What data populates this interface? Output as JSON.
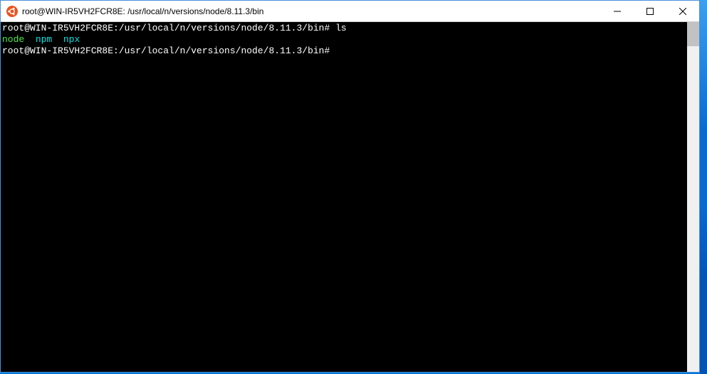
{
  "window": {
    "title": "root@WIN-IR5VH2FCR8E: /usr/local/n/versions/node/8.11.3/bin"
  },
  "terminal": {
    "line1_prompt": "root@WIN-IR5VH2FCR8E:/usr/local/n/versions/node/8.11.3/bin#",
    "line1_cmd": " ls",
    "ls_node": "node",
    "ls_sep1": "  ",
    "ls_npm": "npm",
    "ls_sep2": "  ",
    "ls_npx": "npx",
    "line3_prompt": "root@WIN-IR5VH2FCR8E:/usr/local/n/versions/node/8.11.3/bin#",
    "line3_cursor": " "
  },
  "icons": {
    "app": "ubuntu-icon",
    "minimize": "minimize-icon",
    "maximize": "maximize-icon",
    "close": "close-icon"
  }
}
